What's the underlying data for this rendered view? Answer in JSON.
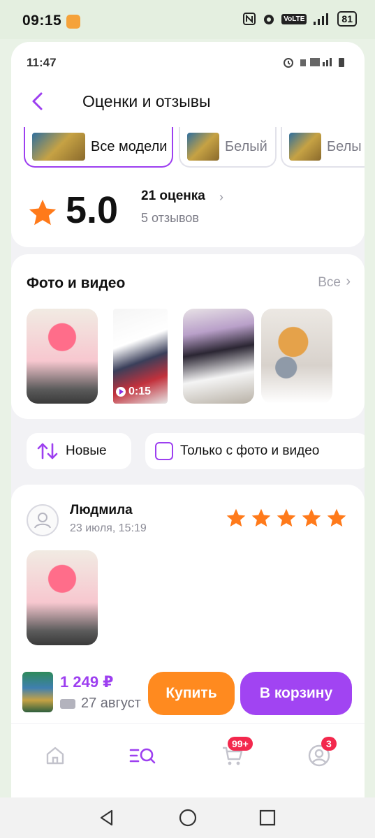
{
  "system_status": {
    "time": "09:15",
    "volte": "VoLTE",
    "network": "4G",
    "battery": "81"
  },
  "inner_status": {
    "time": "11:47"
  },
  "header": {
    "title": "Оценки и отзывы"
  },
  "models": [
    {
      "label": "Все модели",
      "active": true
    },
    {
      "label": "Белый",
      "active": false
    },
    {
      "label": "Белы",
      "active": false
    }
  ],
  "rating": {
    "value": "5.0",
    "count": "21 оценка",
    "reviews": "5 отзывов"
  },
  "media": {
    "title": "Фото и видео",
    "all_label": "Все",
    "video_duration": "0:15"
  },
  "filters": {
    "sort_label": "Новые",
    "photo_only_label": "Только с фото и видео"
  },
  "review": {
    "author": "Людмила",
    "date": "23 июля, 15:19",
    "stars": 5
  },
  "buy_bar": {
    "price": "1 249 ₽",
    "delivery": "27 август",
    "buy_label": "Купить",
    "cart_label": "В корзину"
  },
  "tabbar": {
    "cart_badge": "99+",
    "profile_badge": "3"
  },
  "colors": {
    "accent": "#9d3ff0",
    "buy": "#ff8a1f",
    "star": "#ff7a1a",
    "badge": "#f3284d"
  }
}
